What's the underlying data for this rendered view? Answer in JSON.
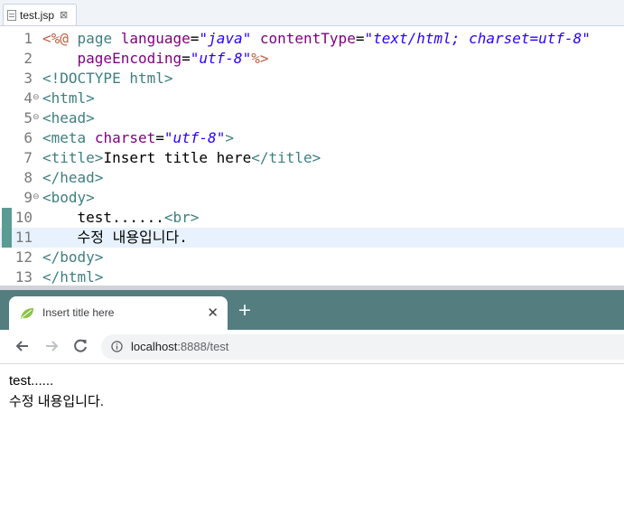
{
  "editor": {
    "tab": {
      "label": "test.jsp",
      "close": "⊠",
      "icon": "jsp-file-icon"
    },
    "current_line": 11,
    "changed_lines": [
      10,
      11
    ],
    "lines": [
      {
        "number": "1",
        "fold": "",
        "tokens": [
          {
            "t": "dir",
            "v": "<%@"
          },
          {
            "t": "txt",
            "v": " "
          },
          {
            "t": "tag",
            "v": "page"
          },
          {
            "t": "txt",
            "v": " "
          },
          {
            "t": "attr",
            "v": "language"
          },
          {
            "t": "txt",
            "v": "="
          },
          {
            "t": "val",
            "v": "\"java\""
          },
          {
            "t": "txt",
            "v": " "
          },
          {
            "t": "attr",
            "v": "contentType"
          },
          {
            "t": "txt",
            "v": "="
          },
          {
            "t": "val",
            "v": "\"text/html; charset=utf-8\""
          }
        ]
      },
      {
        "number": "2",
        "fold": "",
        "tokens": [
          {
            "t": "txt",
            "v": "    "
          },
          {
            "t": "attr",
            "v": "pageEncoding"
          },
          {
            "t": "txt",
            "v": "="
          },
          {
            "t": "val",
            "v": "\"utf-8\""
          },
          {
            "t": "dir",
            "v": "%>"
          }
        ]
      },
      {
        "number": "3",
        "fold": "",
        "tokens": [
          {
            "t": "tag",
            "v": "<!DOCTYPE html>"
          }
        ]
      },
      {
        "number": "4",
        "fold": "⊖",
        "tokens": [
          {
            "t": "tag",
            "v": "<html>"
          }
        ]
      },
      {
        "number": "5",
        "fold": "⊖",
        "tokens": [
          {
            "t": "tag",
            "v": "<head>"
          }
        ]
      },
      {
        "number": "6",
        "fold": "",
        "tokens": [
          {
            "t": "tag",
            "v": "<meta"
          },
          {
            "t": "txt",
            "v": " "
          },
          {
            "t": "attr",
            "v": "charset"
          },
          {
            "t": "txt",
            "v": "="
          },
          {
            "t": "val",
            "v": "\"utf-8\""
          },
          {
            "t": "tag",
            "v": ">"
          }
        ]
      },
      {
        "number": "7",
        "fold": "",
        "tokens": [
          {
            "t": "tag",
            "v": "<title>"
          },
          {
            "t": "txt",
            "v": "Insert title here"
          },
          {
            "t": "tag",
            "v": "</title>"
          }
        ]
      },
      {
        "number": "8",
        "fold": "",
        "tokens": [
          {
            "t": "tag",
            "v": "</head>"
          }
        ]
      },
      {
        "number": "9",
        "fold": "⊖",
        "tokens": [
          {
            "t": "tag",
            "v": "<body>"
          }
        ]
      },
      {
        "number": "10",
        "fold": "",
        "tokens": [
          {
            "t": "txt",
            "v": "    test......"
          },
          {
            "t": "tag",
            "v": "<br>"
          }
        ]
      },
      {
        "number": "11",
        "fold": "",
        "tokens": [
          {
            "t": "txt",
            "v": "    수정 내용입니다."
          }
        ]
      },
      {
        "number": "12",
        "fold": "",
        "tokens": [
          {
            "t": "tag",
            "v": "</body>"
          }
        ]
      },
      {
        "number": "13",
        "fold": "",
        "tokens": [
          {
            "t": "tag",
            "v": "</html>"
          }
        ]
      }
    ]
  },
  "browser": {
    "tab": {
      "title": "Insert title here",
      "close": "✕",
      "favicon": "leaf-icon"
    },
    "new_tab": "+",
    "nav": {
      "back": "back-arrow-icon",
      "forward": "forward-arrow-icon",
      "reload": "reload-icon"
    },
    "address": {
      "host": "localhost",
      "rest": ":8888/test",
      "icon": "info-icon"
    },
    "content": {
      "line1": "test......",
      "line2": "수정 내용입니다."
    },
    "colors": {
      "tabstrip": "#547d80"
    }
  },
  "colors": {
    "directive": "#bf5f3f",
    "tag": "#3f7f7f",
    "attribute": "#7f007f",
    "value": "#2a00ff",
    "current_line": "#e8f2fe",
    "quickdiff": "#5a9c93"
  }
}
